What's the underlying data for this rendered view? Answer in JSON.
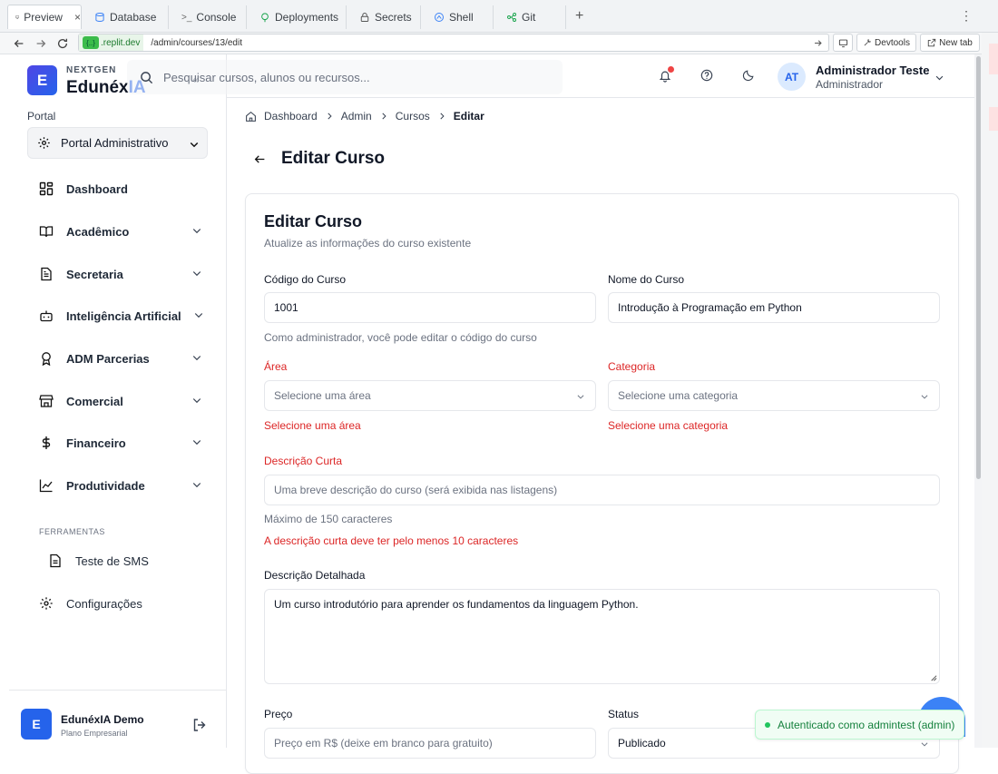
{
  "ide": {
    "tabs": [
      {
        "label": "Preview",
        "icon": "monitor-icon"
      },
      {
        "label": "Database",
        "icon": "database-icon"
      },
      {
        "label": "Console",
        "icon": "terminal-icon"
      },
      {
        "label": "Deployments",
        "icon": "deployments-icon"
      },
      {
        "label": "Secrets",
        "icon": "lock-icon"
      },
      {
        "label": "Shell",
        "icon": "shell-icon"
      },
      {
        "label": "Git",
        "icon": "git-icon"
      }
    ],
    "close_glyph": "×",
    "plus_glyph": "+",
    "more_glyph": "⋮"
  },
  "urlbar": {
    "host": ".replit.dev",
    "path": "/admin/courses/13/edit",
    "devtools_label": "Devtools",
    "newtab_label": "New tab"
  },
  "brand": {
    "logo_letter": "E",
    "small": "NEXTGEN",
    "name_main": "Edunéx",
    "name_accent": "IA",
    "collapse_glyph": "«"
  },
  "sidebar": {
    "portal_label": "Portal",
    "portal_value": "Portal Administrativo",
    "items": [
      {
        "label": "Dashboard",
        "icon": "dashboard-icon",
        "chevron": false
      },
      {
        "label": "Acadêmico",
        "icon": "book-icon",
        "chevron": true
      },
      {
        "label": "Secretaria",
        "icon": "document-icon",
        "chevron": true
      },
      {
        "label": "Inteligência Artificial",
        "icon": "bot-icon",
        "chevron": true
      },
      {
        "label": "ADM Parcerias",
        "icon": "award-icon",
        "chevron": true
      },
      {
        "label": "Comercial",
        "icon": "store-icon",
        "chevron": true
      },
      {
        "label": "Financeiro",
        "icon": "dollar-icon",
        "chevron": true
      },
      {
        "label": "Produtividade",
        "icon": "chart-line-icon",
        "chevron": true
      }
    ],
    "tools_label": "FERRAMENTAS",
    "tools_item": "Teste de SMS",
    "settings_label": "Configurações",
    "footer": {
      "avatar": "E",
      "name": "EdunéxIA Demo",
      "plan": "Plano Empresarial"
    }
  },
  "header": {
    "search_placeholder": "Pesquisar cursos, alunos ou recursos...",
    "avatar_initials": "AT",
    "user_name": "Administrador Teste",
    "user_role": "Administrador"
  },
  "breadcrumb": [
    "Dashboard",
    "Admin",
    "Cursos",
    "Editar"
  ],
  "page_title": "Editar Curso",
  "form": {
    "title": "Editar Curso",
    "subtitle": "Atualize as informações do curso existente",
    "code_label": "Código do Curso",
    "code_value": "1001",
    "code_help": "Como administrador, você pode editar o código do curso",
    "name_label": "Nome do Curso",
    "name_value": "Introdução à Programação em Python",
    "area_label": "Área",
    "area_placeholder": "Selecione uma área",
    "area_error": "Selecione uma área",
    "category_label": "Categoria",
    "category_placeholder": "Selecione uma categoria",
    "category_error": "Selecione uma categoria",
    "short_desc_label": "Descrição Curta",
    "short_desc_placeholder": "Uma breve descrição do curso (será exibida nas listagens)",
    "short_desc_help": "Máximo de 150 caracteres",
    "short_desc_error": "A descrição curta deve ter pelo menos 10 caracteres",
    "long_desc_label": "Descrição Detalhada",
    "long_desc_value": "Um curso introdutório para aprender os fundamentos da linguagem Python.",
    "price_label": "Preço",
    "price_placeholder": "Preço em R$ (deixe em branco para gratuito)",
    "status_label": "Status",
    "status_value": "Publicado"
  },
  "toast": {
    "text": "Autenticado como admintest (admin)"
  },
  "colors": {
    "accent": "#2563eb",
    "error": "#dc2626",
    "success": "#15803d"
  }
}
